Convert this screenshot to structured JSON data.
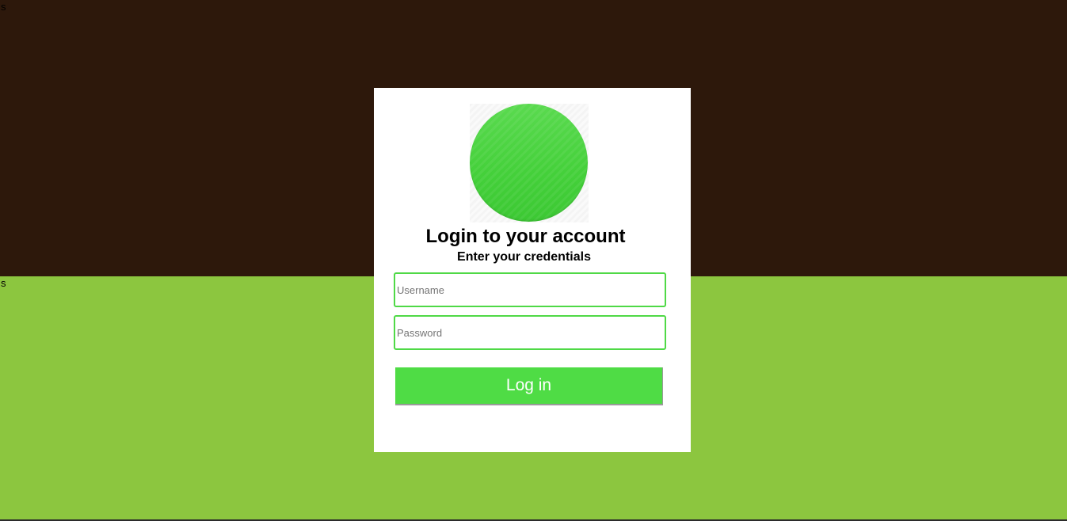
{
  "background": {
    "top_color": "#2d180b",
    "bottom_color": "#8cc63f",
    "top_label": "s",
    "bottom_label": "s"
  },
  "login_card": {
    "avatar_icon": "green-circle-avatar",
    "title": "Login to your account",
    "subtitle": "Enter your credentials",
    "username": {
      "placeholder": "Username",
      "value": ""
    },
    "password": {
      "placeholder": "Password",
      "value": ""
    },
    "login_label": "Log in",
    "accent_color": "#4fdc45"
  }
}
